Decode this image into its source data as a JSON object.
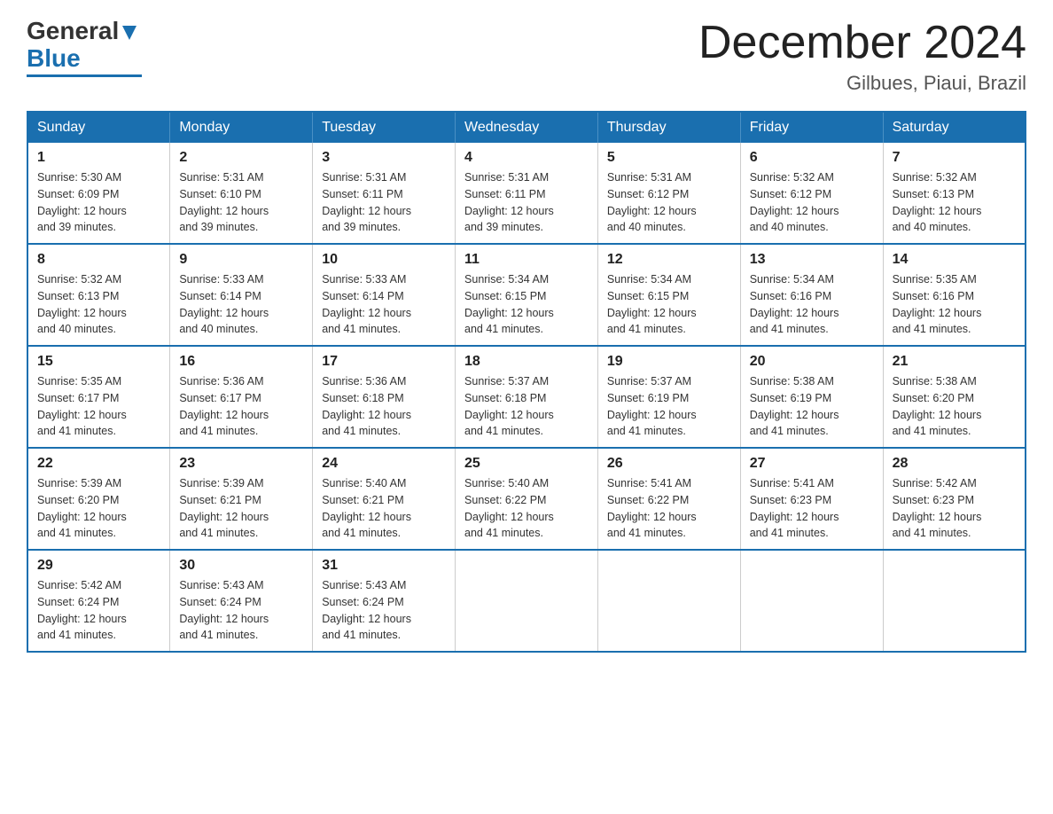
{
  "logo": {
    "text_general": "General",
    "text_blue": "Blue",
    "alt": "GeneralBlue logo"
  },
  "header": {
    "month": "December 2024",
    "location": "Gilbues, Piaui, Brazil"
  },
  "weekdays": [
    "Sunday",
    "Monday",
    "Tuesday",
    "Wednesday",
    "Thursday",
    "Friday",
    "Saturday"
  ],
  "weeks": [
    [
      {
        "day": "1",
        "sunrise": "5:30 AM",
        "sunset": "6:09 PM",
        "daylight": "12 hours and 39 minutes."
      },
      {
        "day": "2",
        "sunrise": "5:31 AM",
        "sunset": "6:10 PM",
        "daylight": "12 hours and 39 minutes."
      },
      {
        "day": "3",
        "sunrise": "5:31 AM",
        "sunset": "6:11 PM",
        "daylight": "12 hours and 39 minutes."
      },
      {
        "day": "4",
        "sunrise": "5:31 AM",
        "sunset": "6:11 PM",
        "daylight": "12 hours and 39 minutes."
      },
      {
        "day": "5",
        "sunrise": "5:31 AM",
        "sunset": "6:12 PM",
        "daylight": "12 hours and 40 minutes."
      },
      {
        "day": "6",
        "sunrise": "5:32 AM",
        "sunset": "6:12 PM",
        "daylight": "12 hours and 40 minutes."
      },
      {
        "day": "7",
        "sunrise": "5:32 AM",
        "sunset": "6:13 PM",
        "daylight": "12 hours and 40 minutes."
      }
    ],
    [
      {
        "day": "8",
        "sunrise": "5:32 AM",
        "sunset": "6:13 PM",
        "daylight": "12 hours and 40 minutes."
      },
      {
        "day": "9",
        "sunrise": "5:33 AM",
        "sunset": "6:14 PM",
        "daylight": "12 hours and 40 minutes."
      },
      {
        "day": "10",
        "sunrise": "5:33 AM",
        "sunset": "6:14 PM",
        "daylight": "12 hours and 41 minutes."
      },
      {
        "day": "11",
        "sunrise": "5:34 AM",
        "sunset": "6:15 PM",
        "daylight": "12 hours and 41 minutes."
      },
      {
        "day": "12",
        "sunrise": "5:34 AM",
        "sunset": "6:15 PM",
        "daylight": "12 hours and 41 minutes."
      },
      {
        "day": "13",
        "sunrise": "5:34 AM",
        "sunset": "6:16 PM",
        "daylight": "12 hours and 41 minutes."
      },
      {
        "day": "14",
        "sunrise": "5:35 AM",
        "sunset": "6:16 PM",
        "daylight": "12 hours and 41 minutes."
      }
    ],
    [
      {
        "day": "15",
        "sunrise": "5:35 AM",
        "sunset": "6:17 PM",
        "daylight": "12 hours and 41 minutes."
      },
      {
        "day": "16",
        "sunrise": "5:36 AM",
        "sunset": "6:17 PM",
        "daylight": "12 hours and 41 minutes."
      },
      {
        "day": "17",
        "sunrise": "5:36 AM",
        "sunset": "6:18 PM",
        "daylight": "12 hours and 41 minutes."
      },
      {
        "day": "18",
        "sunrise": "5:37 AM",
        "sunset": "6:18 PM",
        "daylight": "12 hours and 41 minutes."
      },
      {
        "day": "19",
        "sunrise": "5:37 AM",
        "sunset": "6:19 PM",
        "daylight": "12 hours and 41 minutes."
      },
      {
        "day": "20",
        "sunrise": "5:38 AM",
        "sunset": "6:19 PM",
        "daylight": "12 hours and 41 minutes."
      },
      {
        "day": "21",
        "sunrise": "5:38 AM",
        "sunset": "6:20 PM",
        "daylight": "12 hours and 41 minutes."
      }
    ],
    [
      {
        "day": "22",
        "sunrise": "5:39 AM",
        "sunset": "6:20 PM",
        "daylight": "12 hours and 41 minutes."
      },
      {
        "day": "23",
        "sunrise": "5:39 AM",
        "sunset": "6:21 PM",
        "daylight": "12 hours and 41 minutes."
      },
      {
        "day": "24",
        "sunrise": "5:40 AM",
        "sunset": "6:21 PM",
        "daylight": "12 hours and 41 minutes."
      },
      {
        "day": "25",
        "sunrise": "5:40 AM",
        "sunset": "6:22 PM",
        "daylight": "12 hours and 41 minutes."
      },
      {
        "day": "26",
        "sunrise": "5:41 AM",
        "sunset": "6:22 PM",
        "daylight": "12 hours and 41 minutes."
      },
      {
        "day": "27",
        "sunrise": "5:41 AM",
        "sunset": "6:23 PM",
        "daylight": "12 hours and 41 minutes."
      },
      {
        "day": "28",
        "sunrise": "5:42 AM",
        "sunset": "6:23 PM",
        "daylight": "12 hours and 41 minutes."
      }
    ],
    [
      {
        "day": "29",
        "sunrise": "5:42 AM",
        "sunset": "6:24 PM",
        "daylight": "12 hours and 41 minutes."
      },
      {
        "day": "30",
        "sunrise": "5:43 AM",
        "sunset": "6:24 PM",
        "daylight": "12 hours and 41 minutes."
      },
      {
        "day": "31",
        "sunrise": "5:43 AM",
        "sunset": "6:24 PM",
        "daylight": "12 hours and 41 minutes."
      },
      null,
      null,
      null,
      null
    ]
  ],
  "labels": {
    "sunrise": "Sunrise:",
    "sunset": "Sunset:",
    "daylight": "Daylight:"
  }
}
